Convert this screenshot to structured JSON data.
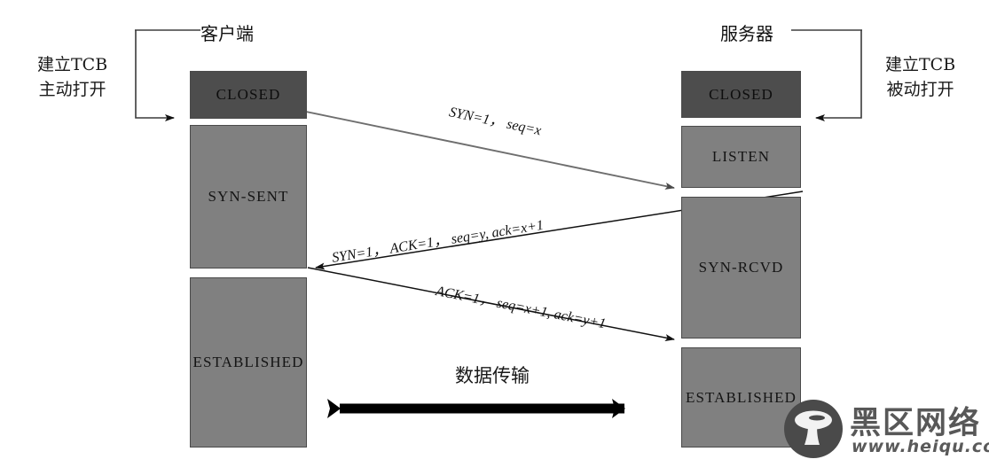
{
  "diagram": {
    "title_client": "客户端",
    "title_server": "服务器",
    "note_client": [
      "建立TCB",
      "主动打开"
    ],
    "note_server": [
      "建立TCB",
      "被动打开"
    ],
    "data_transfer_label": "数据传输"
  },
  "client_states": [
    {
      "label": "CLOSED",
      "shade": "dark"
    },
    {
      "label": "SYN-SENT",
      "shade": "light"
    },
    {
      "label": "ESTABLISHED",
      "shade": "light"
    }
  ],
  "server_states": [
    {
      "label": "CLOSED",
      "shade": "dark"
    },
    {
      "label": "LISTEN",
      "shade": "light"
    },
    {
      "label": "SYN-RCVD",
      "shade": "light"
    },
    {
      "label": "ESTABLISHED",
      "shade": "light"
    }
  ],
  "messages": [
    {
      "id": "syn",
      "text": "SYN=1，  seq=x",
      "direction": "client-to-server"
    },
    {
      "id": "syn-ack",
      "text": "SYN=1，  ACK=1，  seq=y, ack=x+1",
      "direction": "server-to-client"
    },
    {
      "id": "ack",
      "text": "ACK=1，  seq=x+1, ack=y+1",
      "direction": "client-to-server"
    }
  ],
  "watermark": {
    "name": "黑区网络",
    "url": "www.heiqu.com"
  },
  "colors": {
    "box_dark": "#4d4d4d",
    "box_light": "#808080",
    "box_border": "#4a4a4a",
    "arrow_black": "#111111",
    "arrow_gray": "#6e6e6e",
    "watermark_gray": "#585858",
    "background": "#ffffff"
  }
}
